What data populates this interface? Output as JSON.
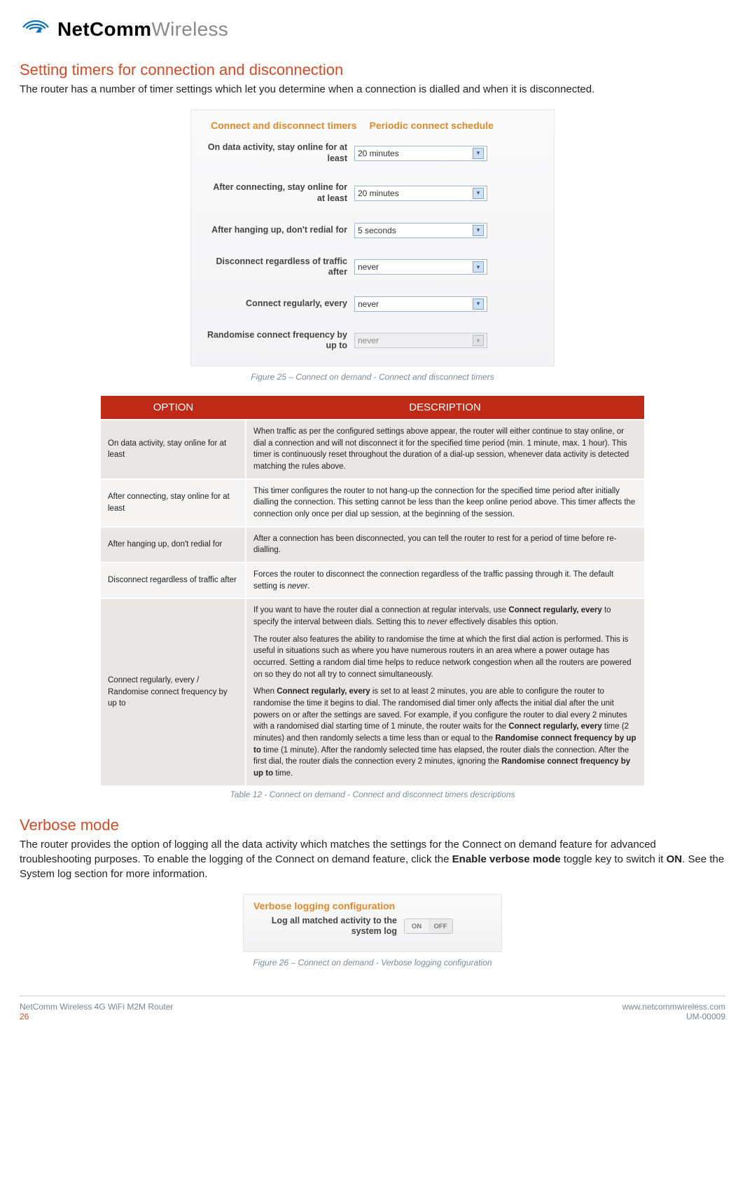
{
  "brand": {
    "strong": "NetComm",
    "light": "Wireless"
  },
  "section1": {
    "title": "Setting timers for connection and disconnection",
    "lead": "The router has a number of timer settings which let you determine when a connection is dialled and when it is disconnected."
  },
  "panel1": {
    "tab_active": "Connect and disconnect timers",
    "tab_inactive": "Periodic connect schedule",
    "rows": [
      {
        "label": "On data activity, stay online for at least",
        "value": "20 minutes",
        "disabled": false
      },
      {
        "label": "After connecting, stay online for at least",
        "value": "20 minutes",
        "disabled": false
      },
      {
        "label": "After hanging up, don't redial for",
        "value": "5 seconds",
        "disabled": false
      },
      {
        "label": "Disconnect regardless of traffic after",
        "value": "never",
        "disabled": false
      },
      {
        "label": "Connect regularly, every",
        "value": "never",
        "disabled": false
      },
      {
        "label": "Randomise connect frequency by up to",
        "value": "never",
        "disabled": true
      }
    ],
    "caption": "Figure 25 – Connect on demand - Connect and disconnect timers"
  },
  "table": {
    "header_option": "OPTION",
    "header_desc": "DESCRIPTION",
    "rows": [
      {
        "option": "On data activity, stay online for at least",
        "desc_html": "When traffic as per the configured settings above appear, the router will either continue to stay online, or dial a connection and will not disconnect it for the specified time period (min. 1 minute, max. 1 hour). This timer is continuously reset throughout the duration of a dial-up session, whenever data activity is detected matching the rules above."
      },
      {
        "option": "After connecting, stay online for at least",
        "desc_html": "This timer configures the router to not hang-up the connection for the specified time period after initially dialling the connection. This setting cannot be less than the keep online period above. This timer affects the connection only once per dial up session, at the beginning of the session."
      },
      {
        "option": "After hanging up, don't redial for",
        "desc_html": "After a connection has been disconnected, you can tell the router to rest for a period of time before re-dialling."
      },
      {
        "option": "Disconnect regardless of traffic after",
        "desc_html": "Forces the router to disconnect the connection regardless of the traffic passing through it. The default setting is <span class=\"ital\">never</span>."
      },
      {
        "option": "Connect regularly, every / Randomise connect frequency by up to",
        "desc_html": "<p>If you want to have the router dial a connection at regular intervals, use <span class=\"bold\">Connect regularly, every</span> to specify the interval between dials. Setting this to <span class=\"ital\">never</span> effectively disables this option.</p><p>The router also features the ability to randomise the time at which the first dial action is performed. This is useful in situations such as where you have numerous routers in an area where a power outage has occurred. Setting a random dial time helps to reduce network congestion when all the routers are powered on so they do not all try to connect simultaneously.</p><p>When <span class=\"bold\">Connect regularly, every</span> is set to at least 2 minutes, you are able to configure the router to randomise the time it begins to dial. The randomised dial timer only affects the initial dial after the unit powers on or after the settings are saved. For example, if you configure the router to dial every 2 minutes with a randomised dial starting time of 1 minute, the router waits for the <span class=\"bold\">Connect regularly, every</span> time (2 minutes) and then randomly selects a time less than or equal to the <span class=\"bold\">Randomise connect frequency by up to</span>  time (1 minute). After the randomly selected time has elapsed, the router dials the connection. After the first dial, the router dials the connection every 2 minutes, ignoring the <span class=\"bold\">Randomise connect frequency by up to</span> time.</p>"
      }
    ],
    "caption": "Table 12 - Connect on demand - Connect and disconnect timers descriptions"
  },
  "section2": {
    "title": "Verbose mode",
    "lead_parts": {
      "pre": "The router provides the option of logging all the data activity which matches the settings for the Connect on demand feature for advanced troubleshooting purposes. To enable the logging of the Connect on demand feature, click the ",
      "bold1": "Enable verbose mode",
      "mid": " toggle key to switch it ",
      "bold2": "ON",
      "post": ". See the System log section for more information."
    }
  },
  "panel2": {
    "title": "Verbose logging configuration",
    "label": "Log all matched activity to the system log",
    "toggle_on": "ON",
    "toggle_off": "OFF",
    "caption": "Figure 26 – Connect on demand - Verbose logging configuration"
  },
  "footer": {
    "left_line1": "NetComm Wireless 4G WiFi M2M Router",
    "left_line2": "26",
    "right_line1": "www.netcommwireless.com",
    "right_line2": "UM-00009"
  }
}
